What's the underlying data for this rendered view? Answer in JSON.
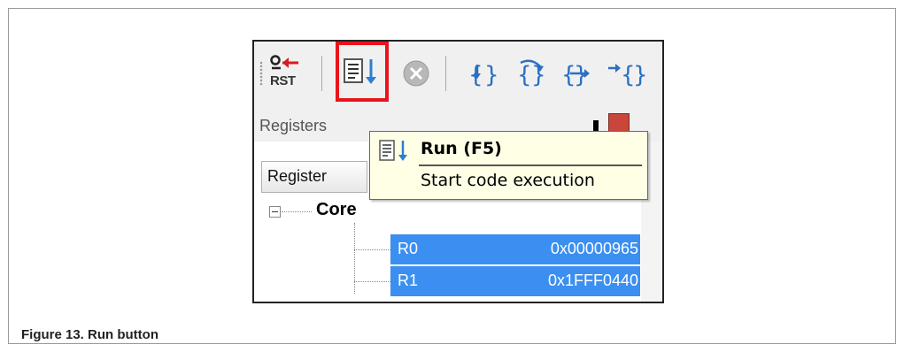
{
  "figure": {
    "caption": "Figure 13.  Run button"
  },
  "toolbar": {
    "reset_label": "RST",
    "icons": [
      "reset-icon",
      "run-icon",
      "stop-icon",
      "step-into-icon",
      "step-over-icon",
      "step-out-icon",
      "run-to-cursor-icon"
    ]
  },
  "tooltip": {
    "title": "Run (F5)",
    "description": "Start code execution"
  },
  "registers_panel": {
    "title": "Registers",
    "column_header": "Register",
    "group": "Core",
    "rows": [
      {
        "name": "R0",
        "value": "0x00000965"
      },
      {
        "name": "R1",
        "value": "0x1FFF0440"
      }
    ]
  },
  "colors": {
    "highlight": "#e8141c",
    "selection": "#3b8ff0",
    "tooltip_bg": "#ffffe6"
  }
}
